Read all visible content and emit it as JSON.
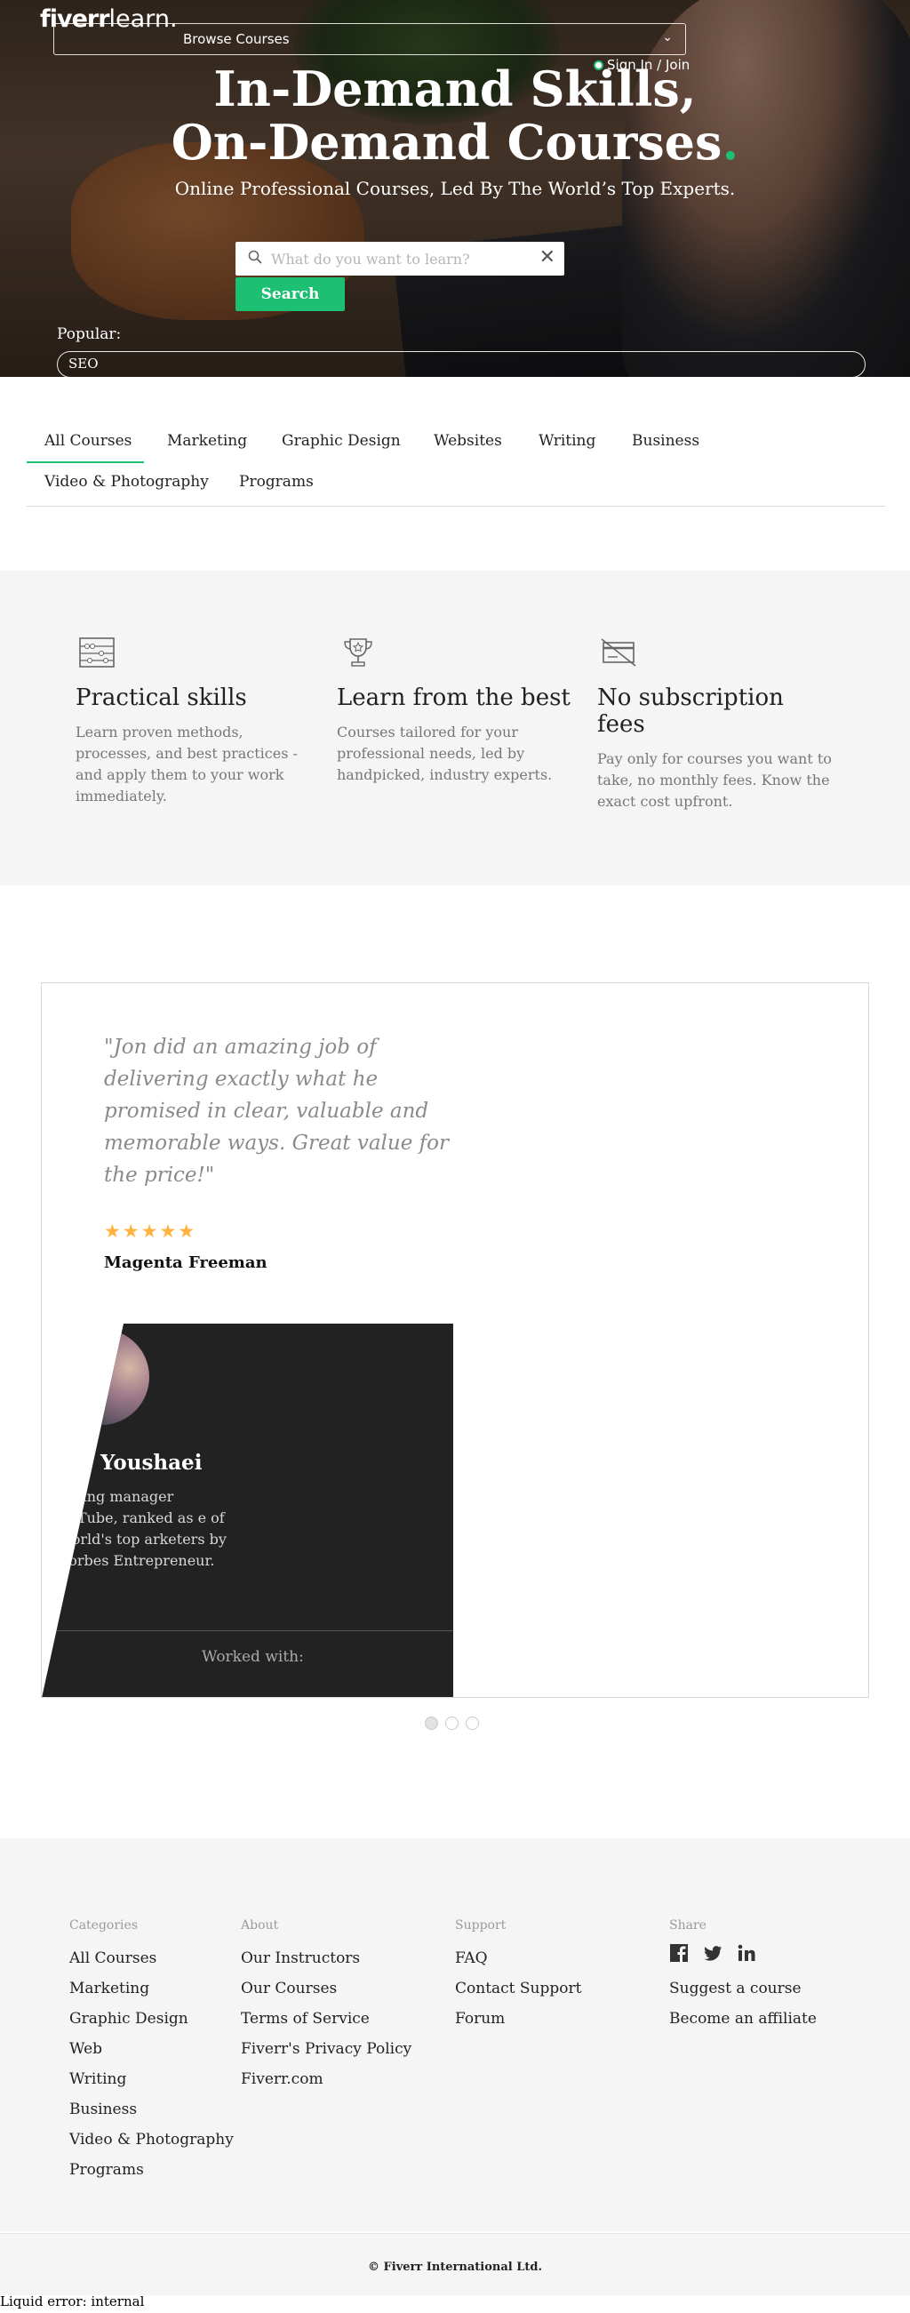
{
  "header": {
    "logo_main": "fiverr",
    "logo_sub": "learn.",
    "browse_label": "Browse Courses",
    "signin_label": "Sign In / Join"
  },
  "hero": {
    "title_line1": "In-Demand Skills,",
    "title_line2": "On-Demand Courses",
    "title_dot": ".",
    "subtitle": "Online Professional Courses, Led By The World’s Top Experts.",
    "search_placeholder": "What do you want to learn?",
    "search_button": "Search",
    "popular_label": "Popular:",
    "popular_tag": "SEO"
  },
  "tabs": [
    {
      "label": "All Courses",
      "active": true
    },
    {
      "label": "Marketing"
    },
    {
      "label": "Graphic Design"
    },
    {
      "label": "Websites"
    },
    {
      "label": "Writing"
    },
    {
      "label": "Business"
    },
    {
      "label": "Video & Photography"
    },
    {
      "label": "Programs"
    }
  ],
  "features": [
    {
      "icon": "abacus-icon",
      "title": "Practical skills",
      "text": "Learn proven methods, processes, and best practices - and apply them to your work immediately."
    },
    {
      "icon": "trophy-icon",
      "title": "Learn from the best",
      "text": "Courses tailored for your professional needs, led by handpicked, industry experts."
    },
    {
      "icon": "no-credit-card-icon",
      "title": "No subscription fees",
      "text": "Pay only for courses you want to take, no monthly fees. Know the exact cost upfront."
    }
  ],
  "testimonial": {
    "quote": "\"Jon did an amazing job of delivering exactly what he promised in clear, valuable and memorable ways. Great value for the price!\"",
    "stars": 5,
    "stars_text": "★★★★★",
    "reviewer": "Magenta Freeman",
    "instructor_name": "Youshaei",
    "instructor_bio": "keting manager ouTube, ranked as e of world's top arketers by Forbes Entrepreneur.",
    "worked_with": "Worked with:",
    "carousel_total": 3,
    "carousel_active": 1
  },
  "footer": {
    "categories_heading": "Categories",
    "categories": [
      "All Courses",
      "Marketing",
      "Graphic Design",
      "Web",
      "Writing",
      "Business",
      "Video & Photography",
      "Programs"
    ],
    "about_heading": "About",
    "about": [
      "Our Instructors",
      "Our Courses",
      "Terms of Service",
      "Fiverr's Privacy Policy",
      "Fiverr.com"
    ],
    "support_heading": "Support",
    "support": [
      "FAQ",
      "Contact Support",
      "Forum"
    ],
    "share_heading": "Share",
    "share_icons": [
      "facebook-icon",
      "twitter-icon",
      "linkedin-icon"
    ],
    "share_links": [
      "Suggest a course",
      "Become an affiliate"
    ],
    "copyright": "© Fiverr International Ltd."
  },
  "error_text": "Liquid error: internal",
  "colors": {
    "accent": "#1dbf73",
    "star": "#ffb33e",
    "panel": "#f5f5f5",
    "instructor_bg": "#222222"
  }
}
